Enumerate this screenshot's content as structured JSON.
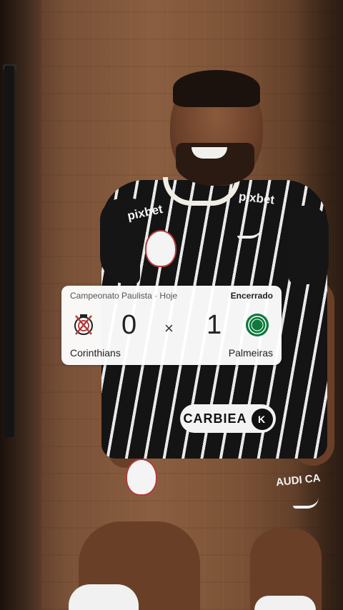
{
  "match_card": {
    "competition": "Campeonato Paulista · Hoje",
    "status": "Encerrado",
    "home_team": {
      "name": "Corinthians",
      "score": "0",
      "crest_icon": "corinthians-crest-icon"
    },
    "away_team": {
      "name": "Palmeiras",
      "score": "1",
      "crest_icon": "palmeiras-crest-icon"
    },
    "separator": "×"
  },
  "jersey": {
    "front_sponsor": "pixbet",
    "chest_sponsor": "CARBIEA",
    "shorts_text": "AUDI CA"
  },
  "colors": {
    "card_bg": "#ffffff",
    "palmeiras_green": "#0b7a3b",
    "corinthians_red": "#b43b3b",
    "jersey_black": "#141414"
  }
}
